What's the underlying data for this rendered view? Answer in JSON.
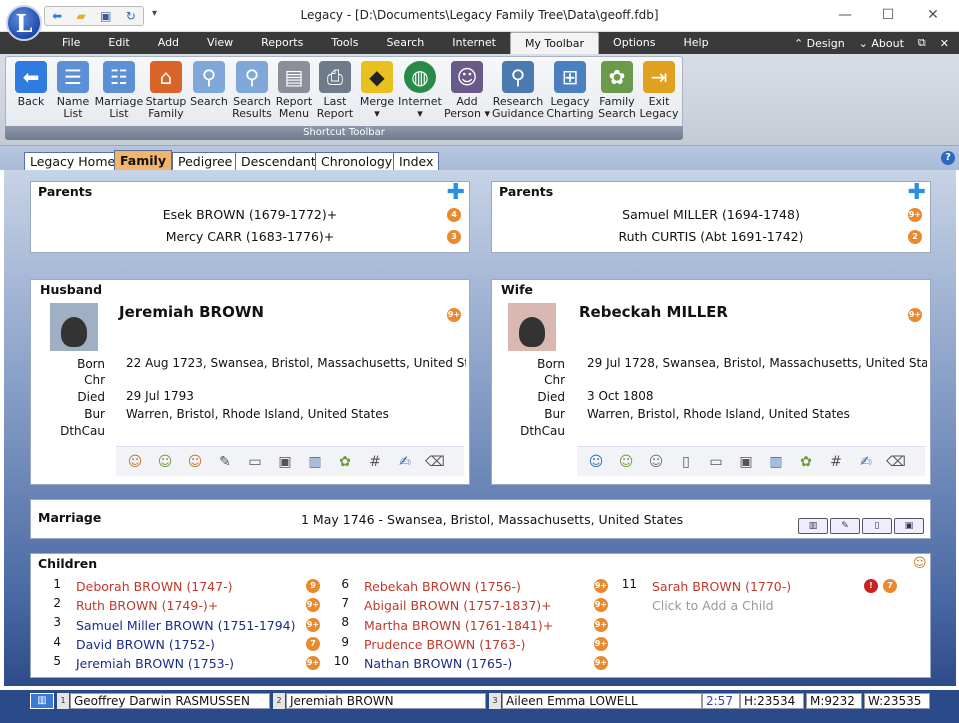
{
  "app": {
    "logo_letter": "L",
    "title": "Legacy - [D:\\Documents\\Legacy Family Tree\\Data\\geoff.fdb]"
  },
  "window_controls": {
    "minimize": "—",
    "maximize": "☐",
    "close": "✕"
  },
  "menu": {
    "items": [
      "File",
      "Edit",
      "Add",
      "View",
      "Reports",
      "Tools",
      "Search",
      "Internet",
      "My Toolbar",
      "Options",
      "Help"
    ],
    "active": "My Toolbar",
    "right": [
      "⌃ Design",
      "⌄ About",
      "⧉",
      "✕"
    ]
  },
  "toolbar": {
    "caption": "Shortcut Toolbar",
    "buttons": [
      {
        "l1": "Back",
        "l2": "",
        "icon": "back-arrow-icon",
        "color": "#2f7be0"
      },
      {
        "l1": "Name",
        "l2": "List",
        "icon": "name-list-icon",
        "color": "#5b8fd6"
      },
      {
        "l1": "Marriage",
        "l2": "List",
        "icon": "marriage-list-icon",
        "color": "#5b8fd6"
      },
      {
        "l1": "Startup",
        "l2": "Family",
        "icon": "house-icon",
        "color": "#d8642a"
      },
      {
        "l1": "Search",
        "l2": "",
        "icon": "magnifier-icon",
        "color": "#7fa8d8"
      },
      {
        "l1": "Search",
        "l2": "Results",
        "icon": "search-results-icon",
        "color": "#7fa8d8"
      },
      {
        "l1": "Report",
        "l2": "Menu",
        "icon": "printer-icon",
        "color": "#8a8f99"
      },
      {
        "l1": "Last",
        "l2": "Report",
        "icon": "last-report-icon",
        "color": "#6f7a8a"
      },
      {
        "l1": "Merge",
        "l2": "▾",
        "icon": "merge-sign-icon",
        "color": "#e8c020"
      },
      {
        "l1": "Internet",
        "l2": "▾",
        "icon": "globe-icon",
        "color": "#2a8a4a"
      },
      {
        "l1": "Add",
        "l2": "Person ▾",
        "icon": "add-person-icon",
        "color": "#6a5a8a"
      },
      {
        "l1": "Research",
        "l2": "Guidance",
        "icon": "research-icon",
        "color": "#4a7ab0"
      },
      {
        "l1": "Legacy",
        "l2": "Charting",
        "icon": "chart-tree-icon",
        "color": "#4a80c0"
      },
      {
        "l1": "Family",
        "l2": "Search",
        "icon": "family-search-icon",
        "color": "#6a9a4a"
      },
      {
        "l1": "Exit",
        "l2": "Legacy",
        "icon": "exit-door-icon",
        "color": "#e0a020"
      }
    ]
  },
  "view_tabs": [
    "Legacy Home",
    "Family",
    "Pedigree",
    "Descendant",
    "Chronology",
    "Index"
  ],
  "active_tab": "Family",
  "parents_left": {
    "title": "Parents",
    "father": {
      "name": "Esek BROWN (1679-1772)+",
      "badge": "4"
    },
    "mother": {
      "name": "Mercy CARR (1683-1776)+",
      "badge": "3"
    }
  },
  "parents_right": {
    "title": "Parents",
    "father": {
      "name": "Samuel MILLER (1694-1748)",
      "badge": "9+"
    },
    "mother": {
      "name": "Ruth CURTIS (Abt 1691-1742)",
      "badge": "2"
    }
  },
  "husband": {
    "title": "Husband",
    "name": "Jeremiah BROWN",
    "badge": "9+",
    "events": [
      {
        "label": "Born",
        "value": "22 Aug 1723, Swansea, Bristol, Massachusetts, United St"
      },
      {
        "label": "Chr",
        "value": ""
      },
      {
        "label": "Died",
        "value": "29 Jul 1793"
      },
      {
        "label": "Bur",
        "value": "Warren, Bristol, Rhode Island, United States"
      },
      {
        "label": "DthCau",
        "value": ""
      }
    ]
  },
  "wife": {
    "title": "Wife",
    "name": "Rebeckah MILLER",
    "badge": "9+",
    "events": [
      {
        "label": "Born",
        "value": "29 Jul 1728, Swansea, Bristol, Massachusetts, United Sta"
      },
      {
        "label": "Chr",
        "value": ""
      },
      {
        "label": "Died",
        "value": "3 Oct 1808"
      },
      {
        "label": "Bur",
        "value": "Warren, Bristol, Rhode Island, United States"
      },
      {
        "label": "DthCau",
        "value": ""
      }
    ]
  },
  "marriage": {
    "title": "Marriage",
    "value": "1 May 1746 - Swansea, Bristol, Massachusetts, United States"
  },
  "children": {
    "title": "Children",
    "list": [
      {
        "num": "1",
        "name": "Deborah BROWN (1747-)",
        "sex": "f",
        "badge": "9"
      },
      {
        "num": "2",
        "name": "Ruth BROWN (1749-)+",
        "sex": "f",
        "badge": "9+"
      },
      {
        "num": "3",
        "name": "Samuel Miller BROWN (1751-1794)",
        "sex": "m",
        "badge": "9+"
      },
      {
        "num": "4",
        "name": "David BROWN (1752-)",
        "sex": "m",
        "badge": "7"
      },
      {
        "num": "5",
        "name": "Jeremiah BROWN (1753-)",
        "sex": "m",
        "badge": "9+"
      },
      {
        "num": "6",
        "name": "Rebekah BROWN (1756-)",
        "sex": "f",
        "badge": "9+"
      },
      {
        "num": "7",
        "name": "Abigail BROWN (1757-1837)+",
        "sex": "f",
        "badge": "9+"
      },
      {
        "num": "8",
        "name": "Martha BROWN (1761-1841)+",
        "sex": "f",
        "badge": "9+"
      },
      {
        "num": "9",
        "name": "Prudence BROWN (1763-)",
        "sex": "f",
        "badge": "9+"
      },
      {
        "num": "10",
        "name": "Nathan BROWN (1765-)",
        "sex": "m",
        "badge": "9+"
      },
      {
        "num": "11",
        "name": "Sarah BROWN (1770-)",
        "sex": "f",
        "badge": "7"
      }
    ],
    "add_prompt": "Click to Add a Child"
  },
  "statusbar": {
    "slot1_num": "1",
    "slot1": "Geoffrey Darwin RASMUSSEN",
    "slot2_num": "2",
    "slot2": "Jeremiah BROWN",
    "slot3_num": "3",
    "slot3": "Aileen Emma LOWELL",
    "time": "2:57",
    "h": "H:23534",
    "m": "M:9232",
    "w": "W:23535"
  }
}
